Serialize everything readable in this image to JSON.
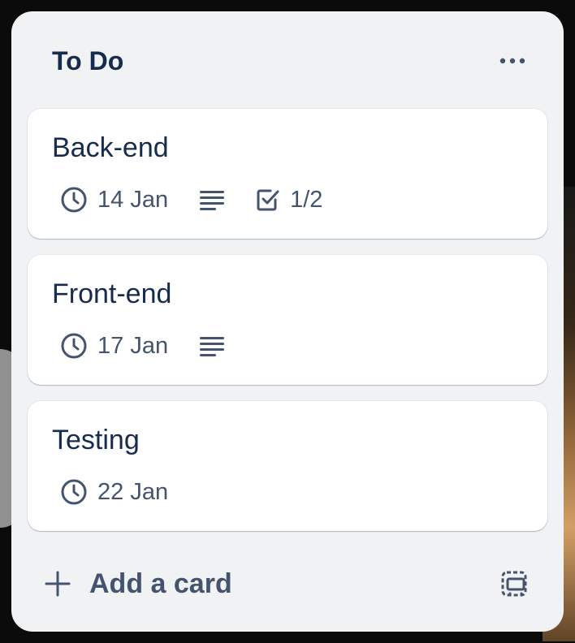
{
  "list": {
    "title": "To Do",
    "menu_icon": "more-horizontal-icon",
    "cards": [
      {
        "title": "Back-end",
        "due": "14 Jan",
        "has_description": true,
        "checklist": "1/2"
      },
      {
        "title": "Front-end",
        "due": "17 Jan",
        "has_description": true
      },
      {
        "title": "Testing",
        "due": "22 Jan"
      }
    ],
    "footer": {
      "add_label": "Add a card",
      "add_icon": "plus-icon",
      "template_icon": "card-template-icon"
    }
  },
  "colors": {
    "list_bg": "#f1f2f4",
    "card_bg": "#ffffff",
    "title_text": "#172b4d",
    "subtle_text": "#44546f"
  }
}
